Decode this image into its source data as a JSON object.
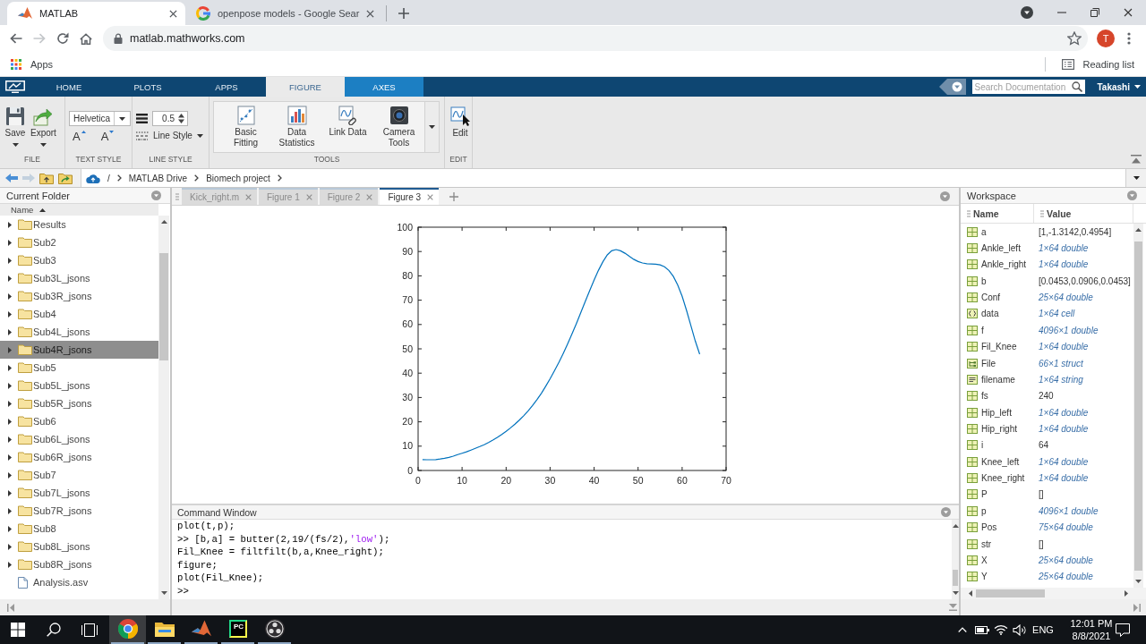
{
  "browser": {
    "tabs": [
      {
        "title": "MATLAB",
        "selected": true
      },
      {
        "title": "openpose models - Google Sear",
        "selected": false
      }
    ],
    "forward_enabled": false,
    "url": "matlab.mathworks.com",
    "profile_initial": "T",
    "bookmarks": [
      "Apps"
    ],
    "reading_list": "Reading list"
  },
  "matlab": {
    "nav_tabs": [
      {
        "label": "HOME",
        "kind": "main",
        "selected": false
      },
      {
        "label": "PLOTS",
        "kind": "main",
        "selected": false
      },
      {
        "label": "APPS",
        "kind": "main",
        "selected": false
      },
      {
        "label": "FIGURE",
        "kind": "contextual",
        "selected": true
      },
      {
        "label": "AXES",
        "kind": "contextual",
        "selected": false
      }
    ],
    "search": {
      "placeholder": "Search Documentation"
    },
    "user": "Takashi",
    "ribbon": [
      {
        "label": "FILE",
        "controls": [
          {
            "kind": "large",
            "label": "Save",
            "dropdown": true
          },
          {
            "kind": "large",
            "label": "Export",
            "dropdown": true
          }
        ]
      },
      {
        "label": "TEXT STYLE",
        "controls": [
          {
            "kind": "select",
            "value": "Helvetica"
          },
          {
            "kind": "glyph",
            "label": "A"
          },
          {
            "kind": "glyph",
            "label": "A"
          }
        ]
      },
      {
        "label": "LINE STYLE",
        "controls": [
          {
            "kind": "spinner",
            "value": "0.5"
          },
          {
            "kind": "menu",
            "label": "Line Style"
          }
        ]
      },
      {
        "label": "TOOLS",
        "controls": [
          {
            "kind": "large",
            "label": "Basic Fitting",
            "dropdown": false
          },
          {
            "kind": "large",
            "label": "Data Statistics",
            "dropdown": false
          },
          {
            "kind": "large",
            "label": "Link Data",
            "dropdown": false
          },
          {
            "kind": "large",
            "label": "Camera Tools",
            "dropdown": false
          },
          {
            "kind": "more"
          }
        ]
      },
      {
        "label": "EDIT",
        "controls": [
          {
            "kind": "large",
            "label": "Edit",
            "dropdown": false
          }
        ]
      }
    ],
    "path": [
      "/",
      "MATLAB Drive",
      "Biomech project"
    ],
    "current_folder": {
      "title": "Current Folder",
      "column": "Name",
      "sorted_ascending": true,
      "items": [
        {
          "name": "Results",
          "kind": "folder",
          "selected": false
        },
        {
          "name": "Sub2",
          "kind": "folder",
          "selected": false
        },
        {
          "name": "Sub3",
          "kind": "folder",
          "selected": false
        },
        {
          "name": "Sub3L_jsons",
          "kind": "folder",
          "selected": false
        },
        {
          "name": "Sub3R_jsons",
          "kind": "folder",
          "selected": false
        },
        {
          "name": "Sub4",
          "kind": "folder",
          "selected": false
        },
        {
          "name": "Sub4L_jsons",
          "kind": "folder",
          "selected": false
        },
        {
          "name": "Sub4R_jsons",
          "kind": "folder",
          "selected": true
        },
        {
          "name": "Sub5",
          "kind": "folder",
          "selected": false
        },
        {
          "name": "Sub5L_jsons",
          "kind": "folder",
          "selected": false
        },
        {
          "name": "Sub5R_jsons",
          "kind": "folder",
          "selected": false
        },
        {
          "name": "Sub6",
          "kind": "folder",
          "selected": false
        },
        {
          "name": "Sub6L_jsons",
          "kind": "folder",
          "selected": false
        },
        {
          "name": "Sub6R_jsons",
          "kind": "folder",
          "selected": false
        },
        {
          "name": "Sub7",
          "kind": "folder",
          "selected": false
        },
        {
          "name": "Sub7L_jsons",
          "kind": "folder",
          "selected": false
        },
        {
          "name": "Sub7R_jsons",
          "kind": "folder",
          "selected": false
        },
        {
          "name": "Sub8",
          "kind": "folder",
          "selected": false
        },
        {
          "name": "Sub8L_jsons",
          "kind": "folder",
          "selected": false
        },
        {
          "name": "Sub8R_jsons",
          "kind": "folder",
          "selected": false
        },
        {
          "name": "Analysis.asv",
          "kind": "file",
          "selected": false
        }
      ]
    },
    "documents": [
      {
        "label": "Kick_right.m",
        "selected": false
      },
      {
        "label": "Figure 1",
        "selected": false
      },
      {
        "label": "Figure 2",
        "selected": false
      },
      {
        "label": "Figure 3",
        "selected": true
      }
    ],
    "figure": {
      "chart_data": {
        "type": "line",
        "x": [
          1,
          2,
          3,
          4,
          5,
          6,
          7,
          8,
          9,
          10,
          11,
          12,
          13,
          14,
          15,
          16,
          17,
          18,
          19,
          20,
          21,
          22,
          23,
          24,
          25,
          26,
          27,
          28,
          29,
          30,
          31,
          32,
          33,
          34,
          35,
          36,
          37,
          38,
          39,
          40,
          41,
          42,
          43,
          44,
          45,
          46,
          47,
          48,
          49,
          50,
          51,
          52,
          53,
          54,
          55,
          56,
          57,
          58,
          59,
          60,
          61,
          62,
          63,
          64
        ],
        "series": [
          {
            "color": "#0072bd",
            "values": [
              4.5,
              4.4,
              4.4,
              4.5,
              4.7,
              5.0,
              5.4,
              5.9,
              6.5,
              7.1,
              7.7,
              8.4,
              9.1,
              9.8,
              10.6,
              11.5,
              12.5,
              13.6,
              14.8,
              16.1,
              17.5,
              19.0,
              20.7,
              22.5,
              24.5,
              26.7,
              29.1,
              31.7,
              34.6,
              37.7,
              41.0,
              44.5,
              48.2,
              52.1,
              56.2,
              60.5,
              65.0,
              69.5,
              74.0,
              78.3,
              82.3,
              85.8,
              88.6,
              90.3,
              90.8,
              90.3,
              89.3,
              88.0,
              86.8,
              85.9,
              85.3,
              85.0,
              84.9,
              84.8,
              84.5,
              83.7,
              82.2,
              79.8,
              76.3,
              71.6,
              65.8,
              59.5,
              53.2,
              47.8
            ]
          }
        ],
        "xlim": [
          0,
          70
        ],
        "ylim": [
          0,
          100
        ],
        "xticks": [
          0,
          10,
          20,
          30,
          40,
          50,
          60,
          70
        ],
        "yticks": [
          0,
          10,
          20,
          30,
          40,
          50,
          60,
          70,
          80,
          90,
          100
        ]
      }
    },
    "command_window": {
      "title": "Command Window",
      "lines": [
        {
          "segments": [
            {
              "text": "plot(t,p);",
              "kind": "code"
            }
          ]
        },
        {
          "segments": [
            {
              "text": ">> [b,a] = butter(2,19/(fs/2),",
              "kind": "code"
            },
            {
              "text": "'low'",
              "kind": "string"
            },
            {
              "text": ");",
              "kind": "code"
            }
          ]
        },
        {
          "segments": [
            {
              "text": "Fil_Knee = filtfilt(b,a,Knee_right);",
              "kind": "code"
            }
          ]
        },
        {
          "segments": [
            {
              "text": "figure;",
              "kind": "code"
            }
          ]
        },
        {
          "segments": [
            {
              "text": "plot(Fil_Knee);",
              "kind": "code"
            }
          ]
        },
        {
          "segments": [
            {
              "text": ">>",
              "kind": "code"
            }
          ]
        }
      ]
    },
    "workspace": {
      "title": "Workspace",
      "columns": [
        "Name",
        "Value"
      ],
      "variables": [
        {
          "name": "a",
          "kind": "matrix",
          "value": "[1,-1.3142,0.4954]",
          "summary": false
        },
        {
          "name": "Ankle_left",
          "kind": "matrix",
          "value": "1×64 double",
          "summary": true
        },
        {
          "name": "Ankle_right",
          "kind": "matrix",
          "value": "1×64 double",
          "summary": true
        },
        {
          "name": "b",
          "kind": "matrix",
          "value": "[0.0453,0.0906,0.0453]",
          "summary": false
        },
        {
          "name": "Conf",
          "kind": "matrix",
          "value": "25×64 double",
          "summary": true
        },
        {
          "name": "data",
          "kind": "cell",
          "value": "1×64 cell",
          "summary": true
        },
        {
          "name": "f",
          "kind": "matrix",
          "value": "4096×1 double",
          "summary": true
        },
        {
          "name": "Fil_Knee",
          "kind": "matrix",
          "value": "1×64 double",
          "summary": true
        },
        {
          "name": "File",
          "kind": "struct",
          "value": "66×1 struct",
          "summary": true
        },
        {
          "name": "filename",
          "kind": "string",
          "value": "1×64 string",
          "summary": true
        },
        {
          "name": "fs",
          "kind": "matrix",
          "value": "240",
          "summary": false
        },
        {
          "name": "Hip_left",
          "kind": "matrix",
          "value": "1×64 double",
          "summary": true
        },
        {
          "name": "Hip_right",
          "kind": "matrix",
          "value": "1×64 double",
          "summary": true
        },
        {
          "name": "i",
          "kind": "matrix",
          "value": "64",
          "summary": false
        },
        {
          "name": "Knee_left",
          "kind": "matrix",
          "value": "1×64 double",
          "summary": true
        },
        {
          "name": "Knee_right",
          "kind": "matrix",
          "value": "1×64 double",
          "summary": true
        },
        {
          "name": "P",
          "kind": "matrix",
          "value": "[]",
          "summary": false
        },
        {
          "name": "p",
          "kind": "matrix",
          "value": "4096×1 double",
          "summary": true
        },
        {
          "name": "Pos",
          "kind": "matrix",
          "value": "75×64 double",
          "summary": true
        },
        {
          "name": "str",
          "kind": "matrix",
          "value": "[]",
          "summary": false
        },
        {
          "name": "X",
          "kind": "matrix",
          "value": "25×64 double",
          "summary": true
        },
        {
          "name": "Y",
          "kind": "matrix",
          "value": "25×64 double",
          "summary": true
        }
      ]
    }
  },
  "taskbar": {
    "apps": [
      {
        "running": true,
        "selected": true
      },
      {
        "running": true,
        "selected": false
      },
      {
        "running": true,
        "selected": false
      },
      {
        "running": true,
        "selected": false,
        "badge": "PC"
      },
      {
        "running": true,
        "selected": false
      }
    ],
    "language": "ENG",
    "time": "12:01 PM",
    "date": "8/8/2021"
  }
}
